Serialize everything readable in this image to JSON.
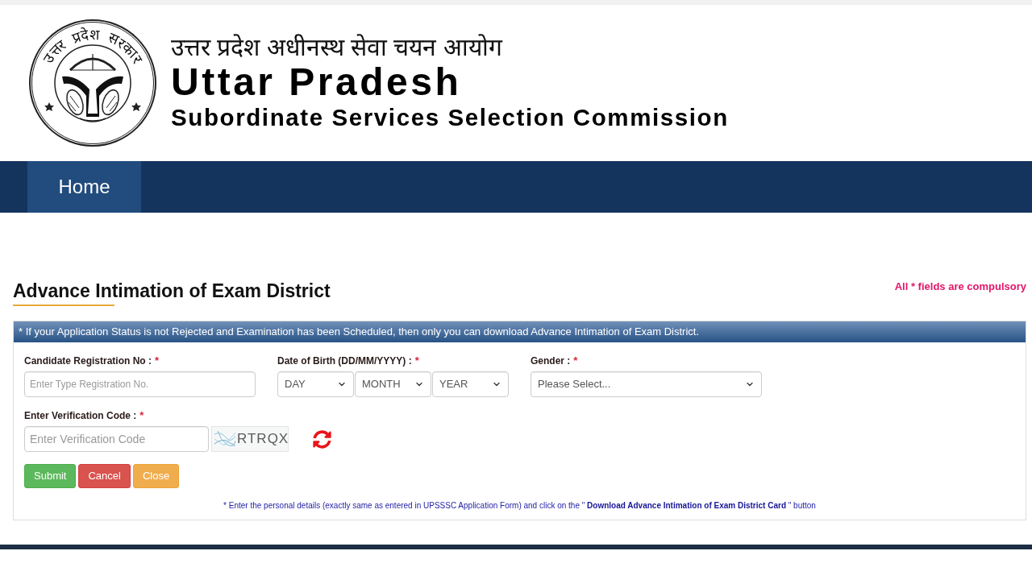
{
  "header": {
    "emblem_text": "उत्तर प्रदेश सरकार",
    "title_hindi": "उत्तर प्रदेश अधीनस्थ सेवा चयन आयोग",
    "title": "Uttar Pradesh",
    "subtitle": "Subordinate Services Selection Commission"
  },
  "nav": {
    "items": [
      {
        "label": "Home",
        "selected": true
      }
    ]
  },
  "page": {
    "title": "Advance Intimation of Exam District",
    "required_note": "All * fields are compulsory"
  },
  "form": {
    "notice": "* If your Application Status is not Rejected and Examination has been Scheduled, then only you can download Advance Intimation of Exam District.",
    "fields": [
      {
        "kind": "text",
        "label": "Candidate Registration No :",
        "required_mark": "*",
        "placeholder": "Enter Type Registration No."
      },
      {
        "kind": "date",
        "label": "Date of Birth (DD/MM/YYYY) :",
        "required_mark": "*",
        "selects": [
          {
            "value": "DAY"
          },
          {
            "value": "MONTH"
          },
          {
            "value": "YEAR"
          }
        ]
      },
      {
        "kind": "select",
        "label": "Gender :",
        "required_mark": "*",
        "value": "Please Select..."
      }
    ],
    "verification": {
      "label": "Enter Verification Code :",
      "required_mark": "*",
      "placeholder": "Enter Verification Code",
      "captcha": "RTRQX"
    },
    "buttons": [
      {
        "label": "Submit",
        "kind": "success"
      },
      {
        "label": "Cancel",
        "kind": "danger"
      },
      {
        "label": "Close",
        "kind": "warning"
      }
    ],
    "footnote": "* Enter the personal details (exactly same as entered in UPSSSC Application Form) and click on the \" **Download Advance Intimation of Exam District Card** \" button"
  }
}
